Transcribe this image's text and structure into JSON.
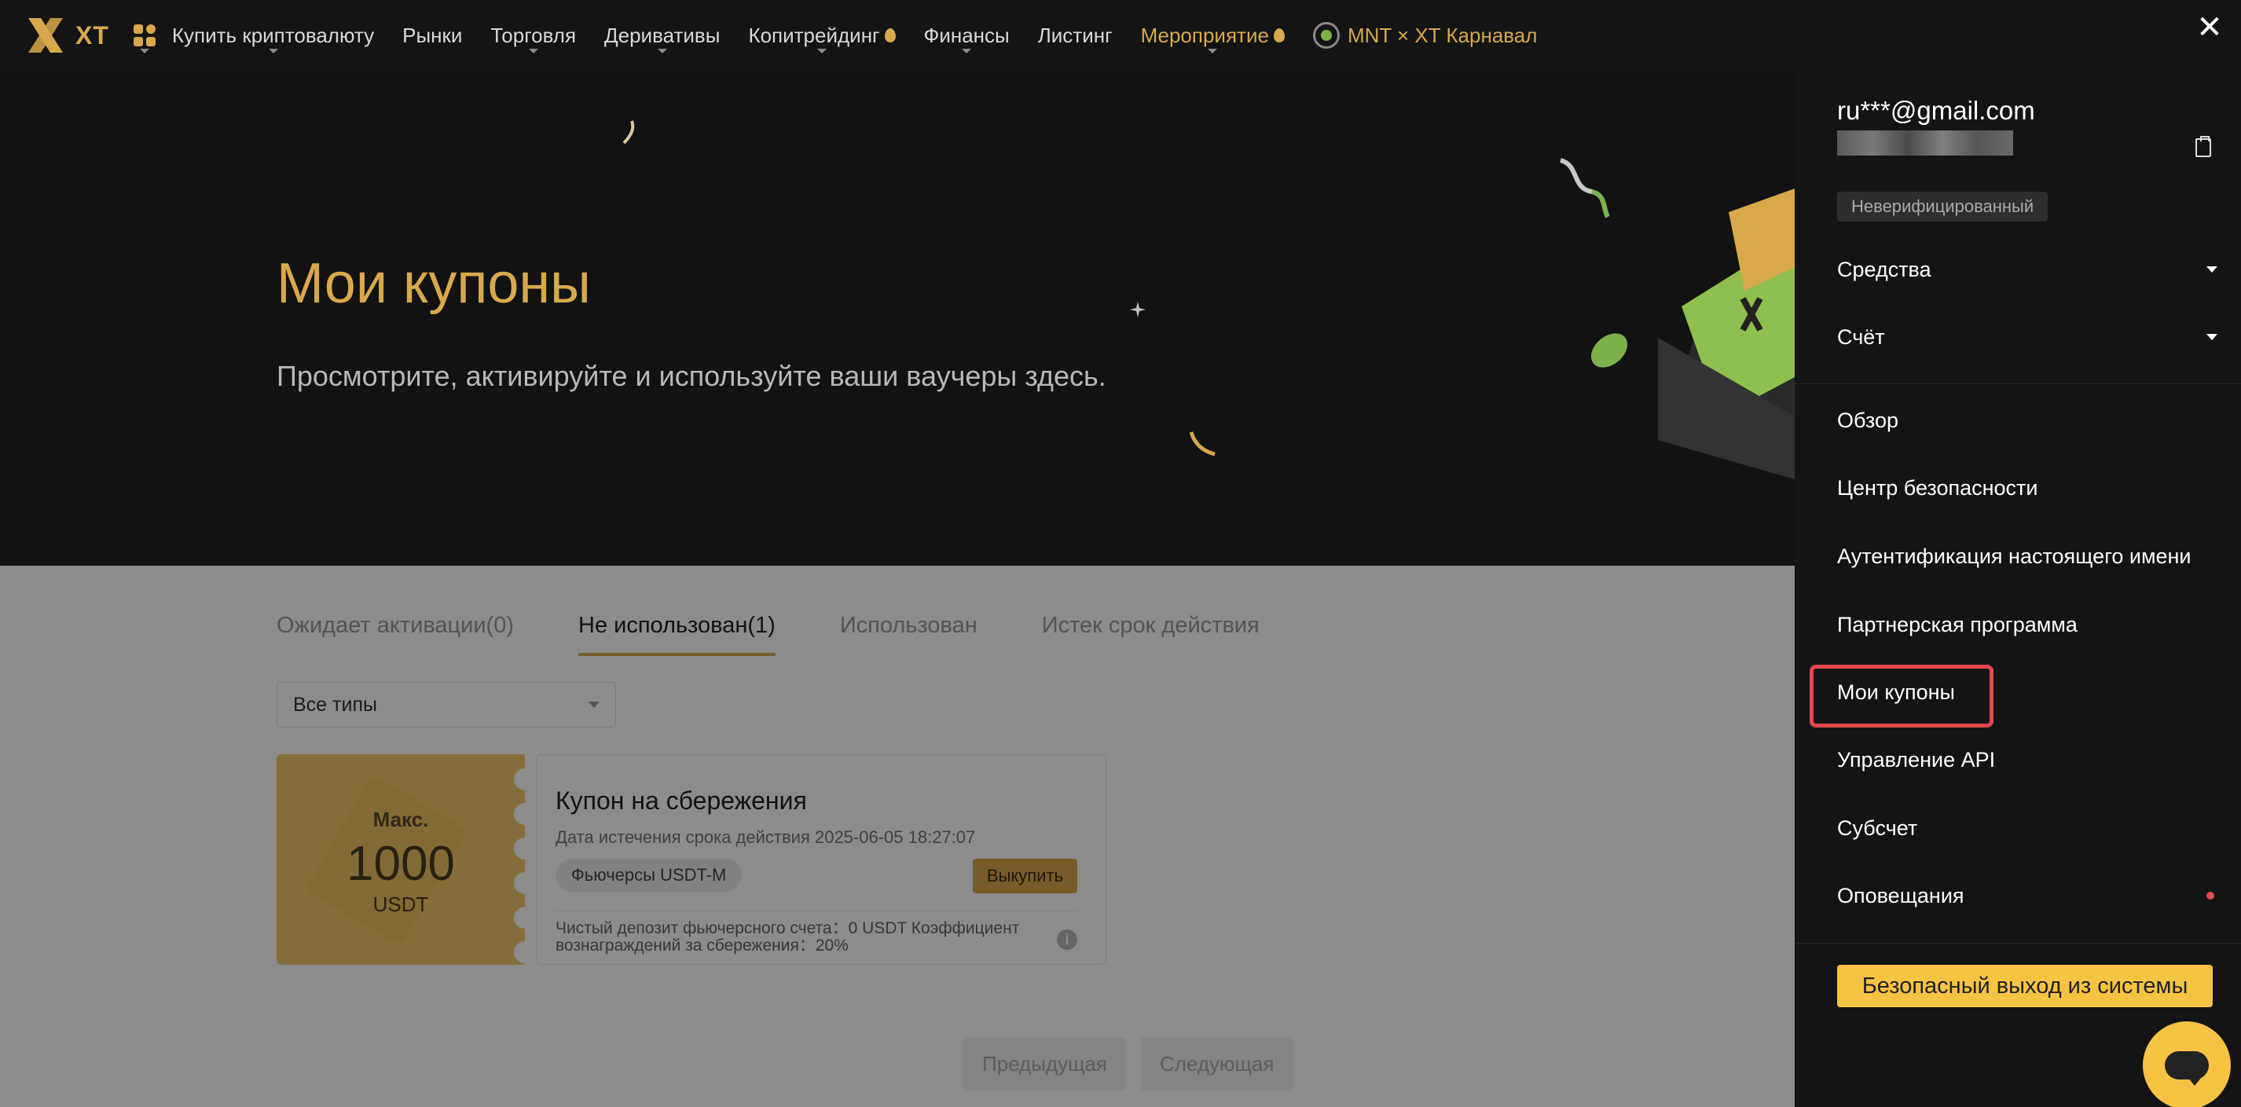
{
  "nav": {
    "logo_text": "XT",
    "items": [
      {
        "label": "Купить криптовалюту"
      },
      {
        "label": "Рынки"
      },
      {
        "label": "Торговля"
      },
      {
        "label": "Деривативы"
      },
      {
        "label": "Копитрейдинг"
      },
      {
        "label": "Финансы"
      },
      {
        "label": "Листинг"
      },
      {
        "label": "Мероприятие"
      }
    ],
    "carnival_label": "MNT × XT Карнавал"
  },
  "hero": {
    "title": "Мои купоны",
    "subtitle": "Просмотрите, активируйте и используйте ваши ваучеры здесь."
  },
  "tabs": [
    {
      "label": "Ожидает активации(0)"
    },
    {
      "label": "Не использован(1)"
    },
    {
      "label": "Использован"
    },
    {
      "label": "Истек срок действия"
    }
  ],
  "filter": {
    "selected": "Все типы"
  },
  "coupon": {
    "max_label": "Макс.",
    "amount": "1000",
    "unit": "USDT",
    "title": "Купон на сбережения",
    "expiry": "Дата истечения срока действия 2025-06-05 18:27:07",
    "tag": "Фьючерсы USDT-M",
    "redeem_label": "Выкупить",
    "note": "Чистый депозит фьючерсного счета：0 USDT  Коэффициент вознаграждений за сбережения：20%"
  },
  "pagination": {
    "prev": "Предыдущая",
    "next": "Следующая"
  },
  "drawer": {
    "email": "ru***@gmail.com",
    "verify_badge": "Неверифицированный",
    "assets": "Средства",
    "account": "Счёт",
    "menu": [
      {
        "label": "Обзор"
      },
      {
        "label": "Центр безопасности"
      },
      {
        "label": "Аутентификация настоящего имени"
      },
      {
        "label": "Партнерская программа"
      },
      {
        "label": "Мои купоны"
      },
      {
        "label": "Управление API"
      },
      {
        "label": "Субсчет"
      },
      {
        "label": "Оповещания"
      }
    ],
    "logout": "Безопасный выход из системы"
  },
  "colors": {
    "accent": "#d8a84b",
    "logout_button": "#f6c343",
    "highlight": "#e5484d",
    "drawer_bg": "#141414",
    "hero_bg": "#121212"
  },
  "icons": {
    "close": "close-icon",
    "copy": "copy-icon",
    "apps": "apps-grid-icon",
    "chat": "chat-icon",
    "info": "info-icon",
    "fire": "fire-icon"
  }
}
